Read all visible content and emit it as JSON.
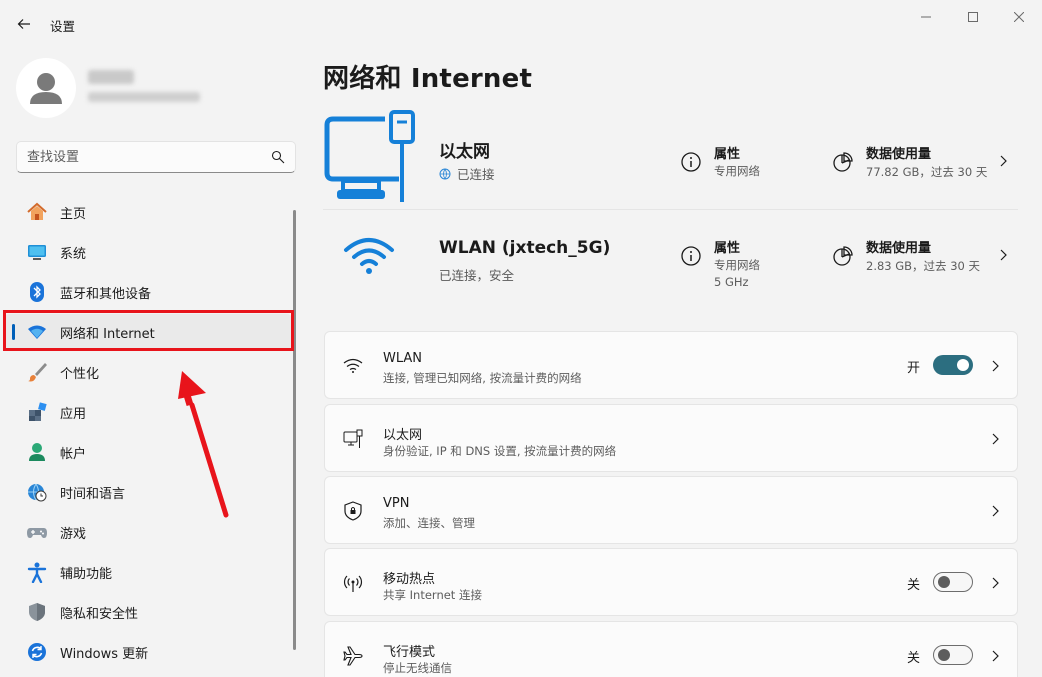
{
  "window": {
    "title": "设置"
  },
  "sidebar": {
    "search_placeholder": "查找设置",
    "items": [
      {
        "label": "主页",
        "icon": "home-icon"
      },
      {
        "label": "系统",
        "icon": "monitor-icon"
      },
      {
        "label": "蓝牙和其他设备",
        "icon": "bluetooth-icon"
      },
      {
        "label": "网络和 Internet",
        "icon": "wifi-icon",
        "active": true
      },
      {
        "label": "个性化",
        "icon": "brush-icon"
      },
      {
        "label": "应用",
        "icon": "apps-icon"
      },
      {
        "label": "帐户",
        "icon": "account-icon"
      },
      {
        "label": "时间和语言",
        "icon": "globe-clock-icon"
      },
      {
        "label": "游戏",
        "icon": "gamepad-icon"
      },
      {
        "label": "辅助功能",
        "icon": "accessibility-icon"
      },
      {
        "label": "隐私和安全性",
        "icon": "shield-icon"
      },
      {
        "label": "Windows 更新",
        "icon": "update-icon"
      }
    ]
  },
  "main": {
    "title": "网络和 Internet",
    "connections": [
      {
        "name": "以太网",
        "status": "已连接",
        "properties_title": "属性",
        "properties_sub": [
          "专用网络"
        ],
        "data_title": "数据使用量",
        "data_sub": "77.82 GB，过去 30 天"
      },
      {
        "name": "WLAN (jxtech_5G)",
        "status": "已连接，安全",
        "properties_title": "属性",
        "properties_sub": [
          "专用网络",
          "5 GHz"
        ],
        "data_title": "数据使用量",
        "data_sub": "2.83 GB，过去 30 天"
      }
    ],
    "settings": [
      {
        "title": "WLAN",
        "desc": "连接, 管理已知网络, 按流量计费的网络",
        "icon": "wifi-icon",
        "toggle_label": "开",
        "toggle_state": "on"
      },
      {
        "title": "以太网",
        "desc": "身份验证, IP 和 DNS 设置, 按流量计费的网络",
        "icon": "ethernet-icon"
      },
      {
        "title": "VPN",
        "desc": "添加、连接、管理",
        "icon": "vpn-shield-icon"
      },
      {
        "title": "移动热点",
        "desc": "共享 Internet 连接",
        "icon": "hotspot-icon",
        "toggle_label": "关",
        "toggle_state": "off"
      },
      {
        "title": "飞行模式",
        "desc": "停止无线通信",
        "icon": "airplane-icon",
        "toggle_label": "关",
        "toggle_state": "off"
      }
    ]
  },
  "colors": {
    "accent": "#005fb8",
    "toggle_on": "#2c6e80",
    "highlight": "#e8141b",
    "ethernet_blue": "#1580d8"
  }
}
